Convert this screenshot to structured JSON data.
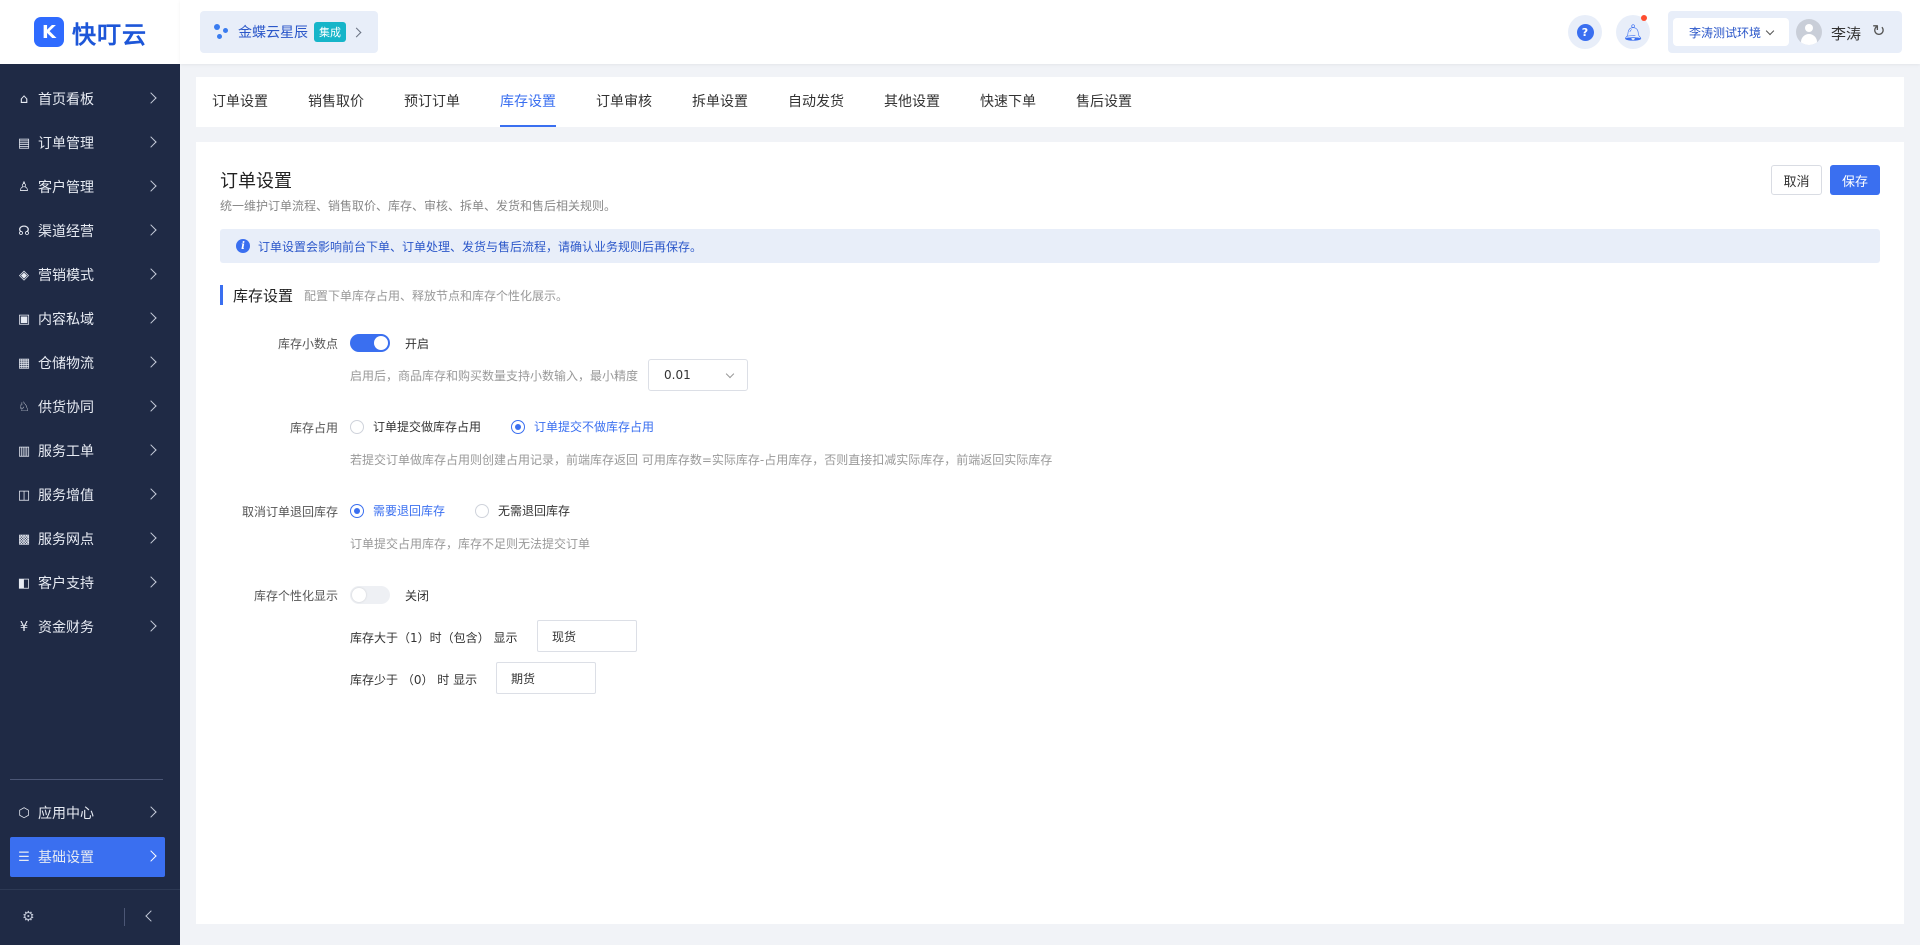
{
  "brand": {
    "logo_glyph": "K",
    "name": "快叮云"
  },
  "header": {
    "org_name": "金蝶云星辰",
    "org_badge": "集成",
    "help_glyph": "?",
    "env": "李涛测试环境",
    "user_name": "李涛"
  },
  "sidebar": {
    "items": [
      {
        "label": "首页看板",
        "icon": "home-icon",
        "glyph": "⌂"
      },
      {
        "label": "订单管理",
        "icon": "order-icon",
        "glyph": "▤"
      },
      {
        "label": "客户管理",
        "icon": "user-icon",
        "glyph": "♙"
      },
      {
        "label": "渠道经营",
        "icon": "channel-icon",
        "glyph": "☊"
      },
      {
        "label": "营销模式",
        "icon": "tag-icon",
        "glyph": "◈"
      },
      {
        "label": "内容私域",
        "icon": "image-icon",
        "glyph": "▣"
      },
      {
        "label": "仓储物流",
        "icon": "warehouse-icon",
        "glyph": "▦"
      },
      {
        "label": "供货协同",
        "icon": "supply-icon",
        "glyph": "♘"
      },
      {
        "label": "服务工单",
        "icon": "ticket-icon",
        "glyph": "▥"
      },
      {
        "label": "服务增值",
        "icon": "bag-icon",
        "glyph": "◫"
      },
      {
        "label": "服务网点",
        "icon": "store-icon",
        "glyph": "▩"
      },
      {
        "label": "客户支持",
        "icon": "support-icon",
        "glyph": "◧"
      },
      {
        "label": "资金财务",
        "icon": "yen-icon",
        "glyph": "¥"
      },
      {
        "label": "应用中心",
        "icon": "cube-icon",
        "glyph": "⬡"
      },
      {
        "label": "基础设置",
        "icon": "settings-icon",
        "glyph": "☰"
      }
    ],
    "active_index": 14
  },
  "tabs": [
    {
      "label": "订单设置"
    },
    {
      "label": "销售取价"
    },
    {
      "label": "预订订单"
    },
    {
      "label": "库存设置"
    },
    {
      "label": "订单审核"
    },
    {
      "label": "拆单设置"
    },
    {
      "label": "自动发货"
    },
    {
      "label": "其他设置"
    },
    {
      "label": "快速下单"
    },
    {
      "label": "售后设置"
    }
  ],
  "active_tab": 3,
  "page": {
    "title": "订单设置",
    "description": "统一维护订单流程、销售取价、库存、审核、拆单、发货和售后相关规则。",
    "cancel_label": "取消",
    "save_label": "保存",
    "notice_glyph": "i",
    "notice": "订单设置会影响前台下单、订单处理、发货与售后流程，请确认业务规则后再保存。"
  },
  "section": {
    "title": "库存设置",
    "description": "配置下单库存占用、释放节点和库存个性化展示。"
  },
  "fields": {
    "decimal": {
      "label": "库存小数点",
      "enabled": true,
      "state_text": "开启",
      "hint": "启用后，商品库存和购买数量支持小数输入，最小精度",
      "precision": "0.01"
    },
    "occupy": {
      "label": "库存占用",
      "options": [
        "订单提交做库存占用",
        "订单提交不做库存占用"
      ],
      "selected": 1,
      "hint": "若提交订单做库存占用则创建占用记录，前端库存返回 可用库存数=实际库存-占用库存，否则直接扣减实际库存，前端返回实际库存"
    },
    "cancel_return": {
      "label": "取消订单退回库存",
      "options": [
        "需要退回库存",
        "无需退回库存"
      ],
      "selected": 0,
      "hint": "订单提交占用库存，库存不足则无法提交订单"
    },
    "personalized": {
      "label": "库存个性化显示",
      "enabled": false,
      "state_text": "关闭",
      "greater_text": "库存大于（1）时（包含） 显示",
      "greater_value": "现货",
      "less_text": "库存少于 （0） 时 显示",
      "less_value": "期货"
    }
  }
}
